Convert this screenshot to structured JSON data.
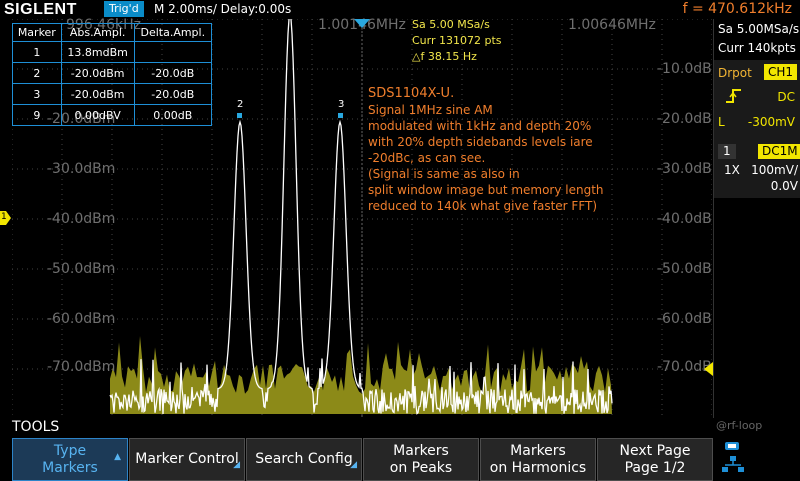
{
  "header": {
    "logo": "SIGLENT",
    "trig_status": "Trig'd",
    "timebase": "M 2.00ms/ Delay:0.00s",
    "freq": "f = 470.612kHz"
  },
  "plot": {
    "y_labels": [
      "-10.0dBm",
      "-20.0dBm",
      "-30.0dBm",
      "-40.0dBm",
      "-50.0dBm",
      "-60.0dBm",
      "-70.0dBm"
    ],
    "x_labels": [
      "996.46kHz",
      "1.00146MHz",
      "1.00646MHz"
    ],
    "channel_marker": "1",
    "marker_labels": [
      "2",
      "3"
    ]
  },
  "marker_table": {
    "headers": [
      "Marker",
      "Abs.Ampl.",
      "Delta.Ampl."
    ],
    "rows": [
      {
        "marker": "1",
        "abs": "13.8mdBm",
        "delta": ""
      },
      {
        "marker": "2",
        "abs": "-20.0dBm",
        "delta": "-20.0dB"
      },
      {
        "marker": "3",
        "abs": "-20.0dBm",
        "delta": "-20.0dB"
      },
      {
        "marker": "9",
        "abs": "0.00dBV",
        "delta": "0.00dB"
      }
    ]
  },
  "sample_info": {
    "sa": "Sa 5.00 MSa/s",
    "curr": "Curr 131072 pts",
    "df": "△f 38.15 Hz"
  },
  "annotation": {
    "lines": [
      "SDS1104X-U.",
      "Signal 1MHz sine AM",
      "modulated with 1kHz and depth 20%",
      "with 20% depth sidebands levels iare",
      "-20dBc, as can see.",
      "(Signal is same as also in",
      "split window image but memory length",
      "reduced to 140k what give faster FFT)"
    ]
  },
  "right_panel": {
    "sa": "Sa 5.00MSa/s",
    "curr": "Curr 140kpts",
    "trigger_source_label": "Drpot",
    "channel_badge": "CH1",
    "coupling": "DC",
    "level_label": "L",
    "level_value": "-300mV",
    "channel_num": "1",
    "input_coupling": "DC1M",
    "probe": "1X",
    "vdiv": "100mV/",
    "offset": "0.0V",
    "watermark": "@rf-loop"
  },
  "tools": {
    "label": "TOOLS",
    "softkeys": [
      {
        "line1": "Type",
        "line2": "Markers",
        "active": true
      },
      {
        "line1": "Marker Control",
        "line2": "",
        "active": false
      },
      {
        "line1": "Search Config",
        "line2": "",
        "active": false
      },
      {
        "line1": "Markers",
        "line2": "on Peaks",
        "active": false
      },
      {
        "line1": "Markers",
        "line2": "on Harmonics",
        "active": false
      },
      {
        "line1": "Next Page",
        "line2": "Page 1/2",
        "active": false
      }
    ]
  },
  "colors": {
    "trace": "#ffffff",
    "noise_fill": "#8c8a18",
    "annotation": "#f07e2c",
    "sample_info": "#f2e64b",
    "accent": "#2d84c8",
    "channel": "#f2e600"
  }
}
